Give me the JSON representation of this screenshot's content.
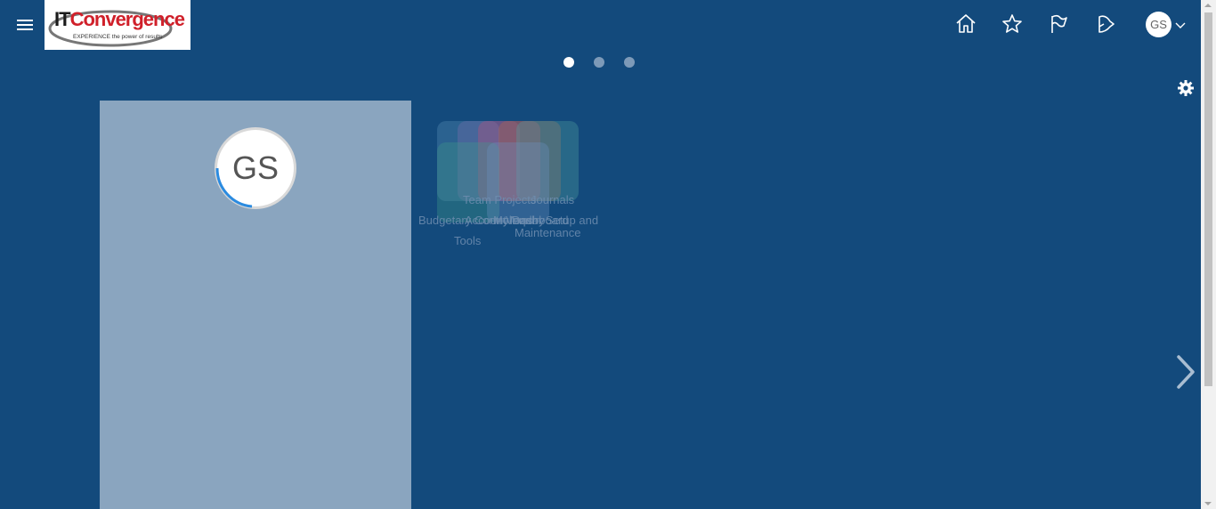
{
  "header": {
    "menu_icon": "hamburger-menu-icon",
    "logo": {
      "brand_it": "IT",
      "brand_rest": "Convergence",
      "tagline": "EXPERIENCE the power of results"
    },
    "icons": [
      "home-icon",
      "star-icon",
      "flag-icon",
      "notifications-icon"
    ],
    "user_initials": "GS",
    "user_menu_icon": "chevron-down-icon"
  },
  "carousel": {
    "dots": 3,
    "active_index": 0
  },
  "profile": {
    "initials": "GS"
  },
  "tiles": {
    "labels": [
      "Budgetary Control and",
      "Tools",
      "Maintenance",
      "Team Projects",
      "Journals",
      "Vendor Setup and",
      "Account Inquiry",
      "My Dashboard"
    ]
  },
  "colors": {
    "background": "#134a7c",
    "panel": "#8aa5bf",
    "accent": "#2b8be0",
    "dot_inactive": "#7d9ab8"
  }
}
